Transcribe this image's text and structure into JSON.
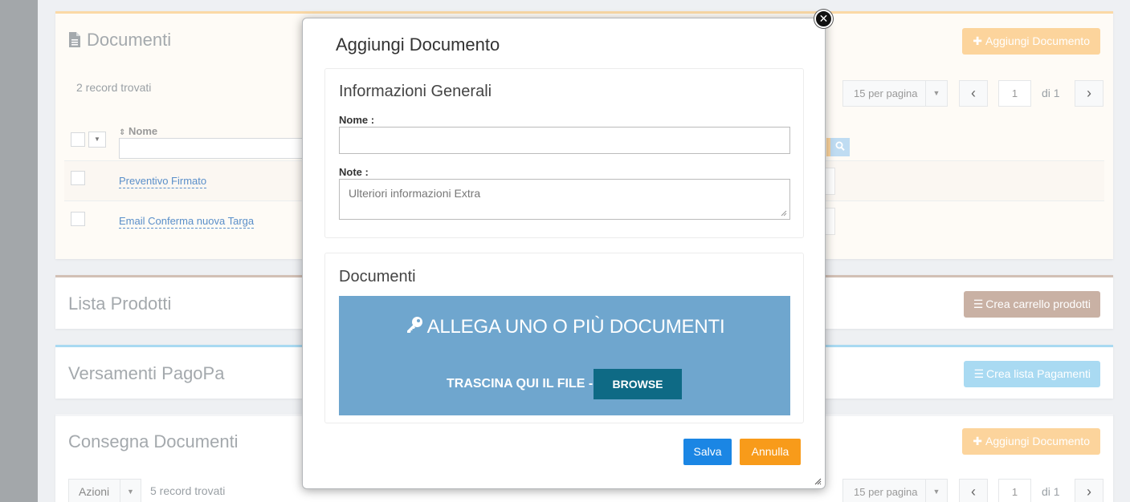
{
  "doc_panel": {
    "title": "Documenti",
    "add_button": "Aggiungi Documento",
    "records": "2 record trovati",
    "per_page": "15 per pagina",
    "page": "1",
    "of_pages": "di 1",
    "col_nome": "Nome",
    "rows": [
      {
        "name": "Preventivo Firmato"
      },
      {
        "name": "Email Conferma nuova Targa"
      }
    ]
  },
  "products_panel": {
    "title": "Lista Prodotti",
    "button": "Crea carrello prodotti"
  },
  "pagopa_panel": {
    "title": "Versamenti PagoPa",
    "button": "Crea lista Pagamenti"
  },
  "delivery_panel": {
    "title": "Consegna Documenti",
    "add_button": "Aggiungi Documento",
    "actions": "Azioni",
    "records": "5 record trovati",
    "per_page": "15 per pagina",
    "page": "1",
    "of_pages": "di 1"
  },
  "modal": {
    "title": "Aggiungi Documento",
    "section_general": "Informazioni Generali",
    "label_nome": "Nome :",
    "nome_value": "",
    "label_note": "Note :",
    "note_placeholder": "Ulteriori informazioni Extra",
    "section_docs": "Documenti",
    "drop_heading": "ALLEGA UNO O PIÙ DOCUMENTI",
    "drop_text": "TRASCINA QUI IL FILE -",
    "browse": "BROWSE",
    "save": "Salva",
    "cancel": "Annulla"
  },
  "colors": {
    "accent_blue": "#1b86e4",
    "cancel_orange": "#f89b1a",
    "dropzone": "#6fa6ce",
    "browse": "#0e6a85"
  },
  "icons": [
    "file-icon",
    "plus-icon",
    "layers-icon",
    "search-icon",
    "key-icon",
    "close-icon",
    "chevron-left-icon",
    "chevron-right-icon",
    "caret-down-icon",
    "sort-icon"
  ]
}
